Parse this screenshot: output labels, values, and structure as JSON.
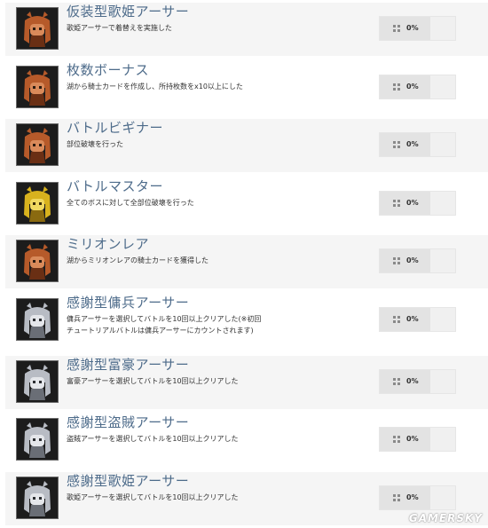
{
  "achievements": [
    {
      "title": "仮装型歌姫アーサー",
      "desc": "歌姫アーサーで着替えを実施した",
      "progress": "0%",
      "progress_value": 0,
      "icon": "bronze-character-icon",
      "tier_color": "#b65a2a"
    },
    {
      "title": "枚数ボーナス",
      "desc": "湖から騎士カードを作成し、所持枚数をx10以上にした",
      "progress": "0%",
      "progress_value": 0,
      "icon": "bronze-character-icon",
      "tier_color": "#b65a2a"
    },
    {
      "title": "バトルビギナー",
      "desc": "部位破壊を行った",
      "progress": "0%",
      "progress_value": 0,
      "icon": "bronze-character-icon",
      "tier_color": "#b65a2a"
    },
    {
      "title": "バトルマスター",
      "desc": "全てのボスに対して全部位破壊を行った",
      "progress": "0%",
      "progress_value": 0,
      "icon": "gold-character-icon",
      "tier_color": "#d8b21e"
    },
    {
      "title": "ミリオンレア",
      "desc": "湖からミリオンレアの騎士カードを獲得した",
      "progress": "0%",
      "progress_value": 0,
      "icon": "bronze-character-icon",
      "tier_color": "#b65a2a"
    },
    {
      "title": "感謝型傭兵アーサー",
      "desc": "傭兵アーサーを選択してバトルを10回以上クリアした(※初回チュートリアルバトルは傭兵アーサーにカウントされます)",
      "progress": "0%",
      "progress_value": 0,
      "icon": "silver-character-icon",
      "tier_color": "#b8bcc4"
    },
    {
      "title": "感謝型富豪アーサー",
      "desc": "富豪アーサーを選択してバトルを10回以上クリアした",
      "progress": "0%",
      "progress_value": 0,
      "icon": "silver-character-icon",
      "tier_color": "#b8bcc4"
    },
    {
      "title": "感謝型盗賊アーサー",
      "desc": "盗賊アーサーを選択してバトルを10回以上クリアした",
      "progress": "0%",
      "progress_value": 0,
      "icon": "silver-character-icon",
      "tier_color": "#b8bcc4"
    },
    {
      "title": "感謝型歌姫アーサー",
      "desc": "歌姫アーサーを選択してバトルを10回以上クリアした",
      "progress": "0%",
      "progress_value": 0,
      "icon": "silver-character-icon",
      "tier_color": "#b8bcc4"
    }
  ],
  "watermark": "GAMERSKY"
}
